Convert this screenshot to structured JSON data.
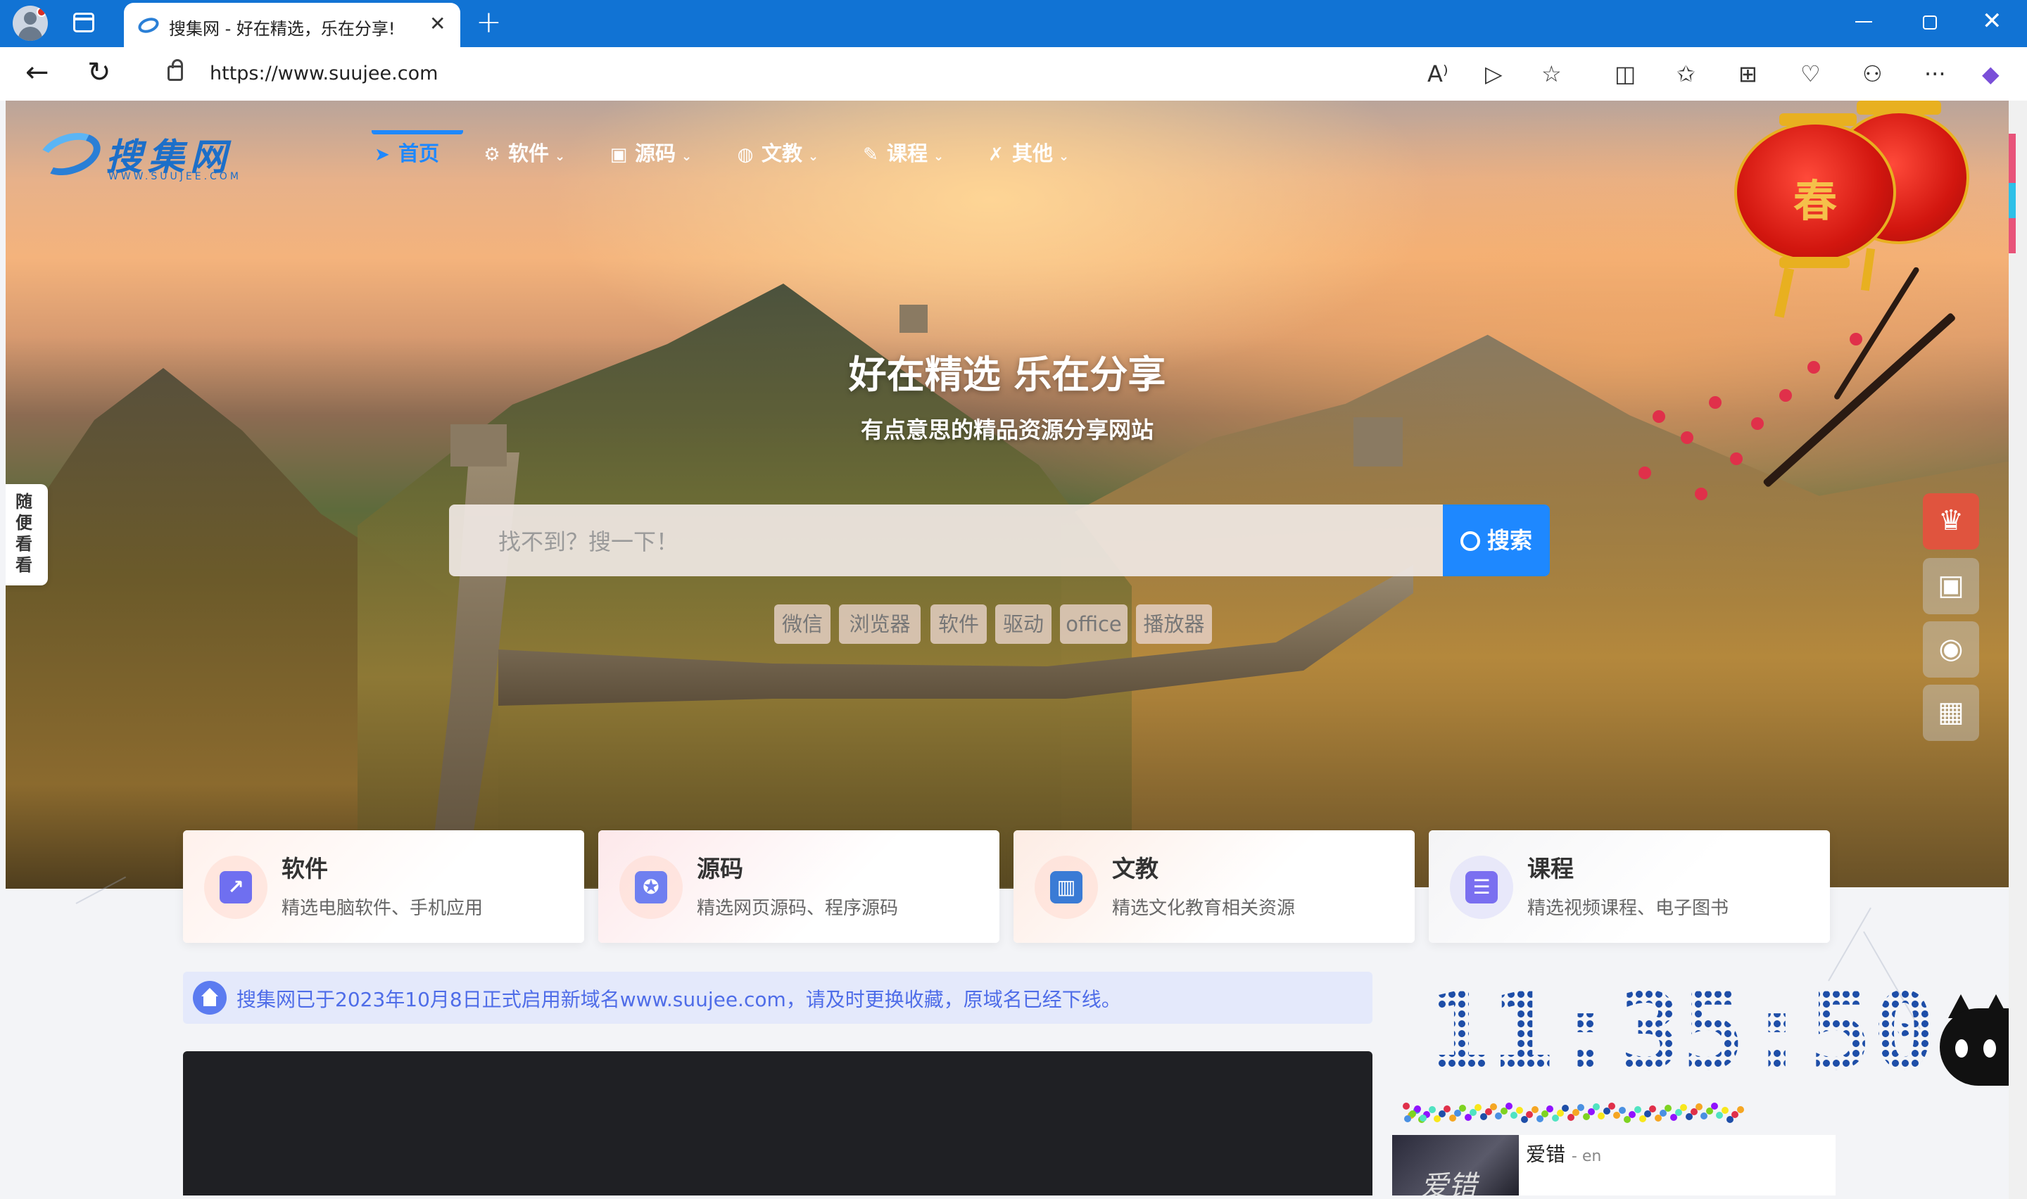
{
  "browser": {
    "tab_title": "搜集网 - 好在精选，乐在分享!",
    "tab_close": "✕",
    "new_tab": "+",
    "url": "https://www.suujee.com",
    "back": "←",
    "reload": "↻",
    "minimize": "—",
    "close": "✕",
    "tools": [
      {
        "name": "read-aloud-icon",
        "glyph": "A⁾"
      },
      {
        "name": "immersive-reader-icon",
        "glyph": "▷"
      },
      {
        "name": "favorite-star-icon",
        "glyph": "☆"
      },
      {
        "name": "split-screen-icon",
        "glyph": "◫"
      },
      {
        "name": "favorites-icon",
        "glyph": "✩"
      },
      {
        "name": "collections-icon",
        "glyph": "⊞"
      },
      {
        "name": "browser-essentials-icon",
        "glyph": "♡"
      },
      {
        "name": "extensions-icon",
        "glyph": "⚇"
      },
      {
        "name": "more-menu-icon",
        "glyph": "···"
      },
      {
        "name": "copilot-icon",
        "glyph": "◆"
      }
    ]
  },
  "site": {
    "logo_text": "搜集网",
    "logo_sub": "WWW.SUUJEE.COM",
    "nav": [
      {
        "label": "首页",
        "icon": "➤",
        "icon_name": "paper-plane-icon",
        "active": true,
        "dropdown": false
      },
      {
        "label": "软件",
        "icon": "⚙",
        "icon_name": "gears-icon",
        "active": false,
        "dropdown": true
      },
      {
        "label": "源码",
        "icon": "▣",
        "icon_name": "code-file-icon",
        "active": false,
        "dropdown": true
      },
      {
        "label": "文教",
        "icon": "◍",
        "icon_name": "compass-icon",
        "active": false,
        "dropdown": true
      },
      {
        "label": "课程",
        "icon": "✎",
        "icon_name": "brush-icon",
        "active": false,
        "dropdown": true
      },
      {
        "label": "其他",
        "icon": "✗",
        "icon_name": "tools-icon",
        "active": false,
        "dropdown": true
      }
    ],
    "chevron": "⌄",
    "hero_title": "好在精选 乐在分享",
    "hero_subtitle": "有点意思的精品资源分享网站",
    "search_placeholder": "找不到？搜一下！",
    "search_button": "搜索",
    "tags": [
      "微信",
      "浏览器",
      "软件",
      "驱动",
      "office",
      "播放器"
    ],
    "side_tab": "随便看看",
    "lantern_char": "春",
    "float_icons": [
      {
        "name": "crown-icon",
        "glyph": "♛"
      },
      {
        "name": "android-icon",
        "glyph": "▣"
      },
      {
        "name": "qq-penguin-icon",
        "glyph": "◉"
      },
      {
        "name": "qr-code-icon",
        "glyph": "▦"
      }
    ],
    "cards": [
      {
        "title": "软件",
        "desc": "精选电脑软件、手机应用",
        "icon": "↗",
        "icon_name": "monitor-chart-icon",
        "color": "#6f6ff0"
      },
      {
        "title": "源码",
        "desc": "精选网页源码、程序源码",
        "icon": "✪",
        "icon_name": "award-badge-icon",
        "color": "#6f7ff0"
      },
      {
        "title": "文教",
        "desc": "精选文化教育相关资源",
        "icon": "▥",
        "icon_name": "open-book-icon",
        "color": "#3a7bd5"
      },
      {
        "title": "课程",
        "desc": "精选视频课程、电子图书",
        "icon": "☰",
        "icon_name": "clipboard-list-icon",
        "color": "#7a6ff0"
      }
    ],
    "notice": "搜集网已于2023年10月8日正式启用新域名www.suujee.com，请及时更换收藏，原域名已经下线。",
    "clock": "11:35:50",
    "song": {
      "title": "爱错",
      "artist": "- en",
      "cover_text": "爱错"
    }
  }
}
